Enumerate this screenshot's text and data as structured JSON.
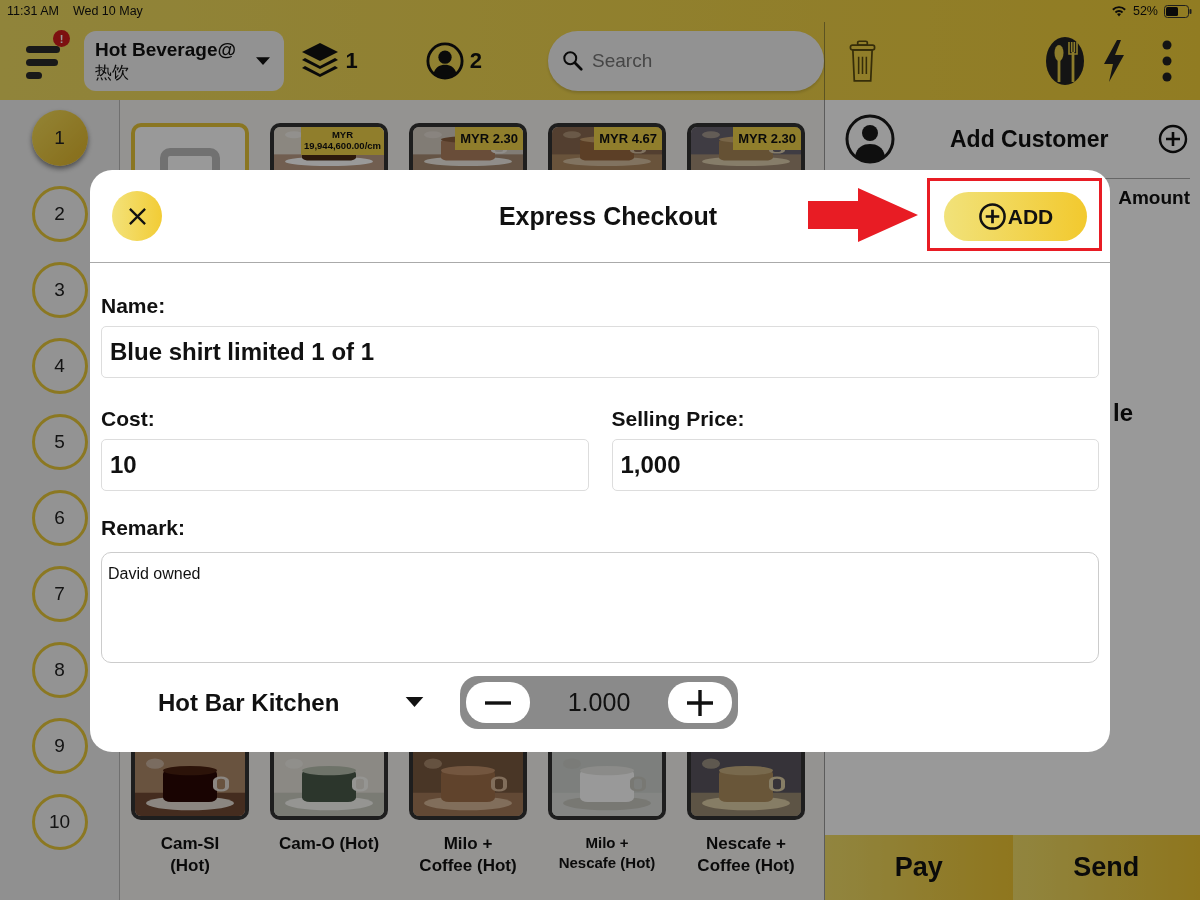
{
  "status_bar": {
    "time": "11:31 AM",
    "date": "Wed 10 May",
    "battery": "52%"
  },
  "header": {
    "menu_badge": "!",
    "category": {
      "label": "Hot Beverage@",
      "sublabel": "热饮"
    },
    "layers_count": "1",
    "guests_count": "2",
    "search": {
      "placeholder": "Search"
    }
  },
  "seat_rail": [
    {
      "label": "1",
      "selected": true
    },
    {
      "label": "2",
      "selected": false
    },
    {
      "label": "3",
      "selected": false
    },
    {
      "label": "4",
      "selected": false
    },
    {
      "label": "5",
      "selected": false
    },
    {
      "label": "6",
      "selected": false
    },
    {
      "label": "7",
      "selected": false
    },
    {
      "label": "8",
      "selected": false
    },
    {
      "label": "9",
      "selected": false
    },
    {
      "label": "10",
      "selected": false
    }
  ],
  "menu_grid": {
    "top_row": [
      {
        "kind": "blank"
      },
      {
        "kind": "item",
        "price": "MYR\n19,944,600.00/cm"
      },
      {
        "kind": "item",
        "price": "MYR 2.30"
      },
      {
        "kind": "item",
        "price": "MYR 4.67"
      },
      {
        "kind": "item",
        "price": "MYR 2.30"
      }
    ],
    "bottom_row": [
      {
        "name": "Cam-SI\n(Hot)"
      },
      {
        "name": "Cam-O (Hot)"
      },
      {
        "name": "Milo +\nCoffee (Hot)"
      },
      {
        "name": "Milo +\nNescafe (Hot)"
      },
      {
        "name": "Nescafe +\nCoffee (Hot)"
      }
    ]
  },
  "order_panel": {
    "customer_label": "Add Customer",
    "column_header": "Amount",
    "empty_text": "le",
    "actions": [
      "Pay",
      "Send"
    ]
  },
  "dialog": {
    "title": "Express Checkout",
    "add_button": {
      "label": "ADD",
      "highlighted": true
    },
    "name_label": "Name:",
    "name_value": "Blue shirt limited 1 of 1",
    "cost_label": "Cost:",
    "cost_value": "10",
    "price_label": "Selling Price:",
    "price_value": "1,000",
    "remark_label": "Remark:",
    "remark_value": "David owned",
    "printer": "Hot Bar Kitchen",
    "quantity": "1.000"
  }
}
